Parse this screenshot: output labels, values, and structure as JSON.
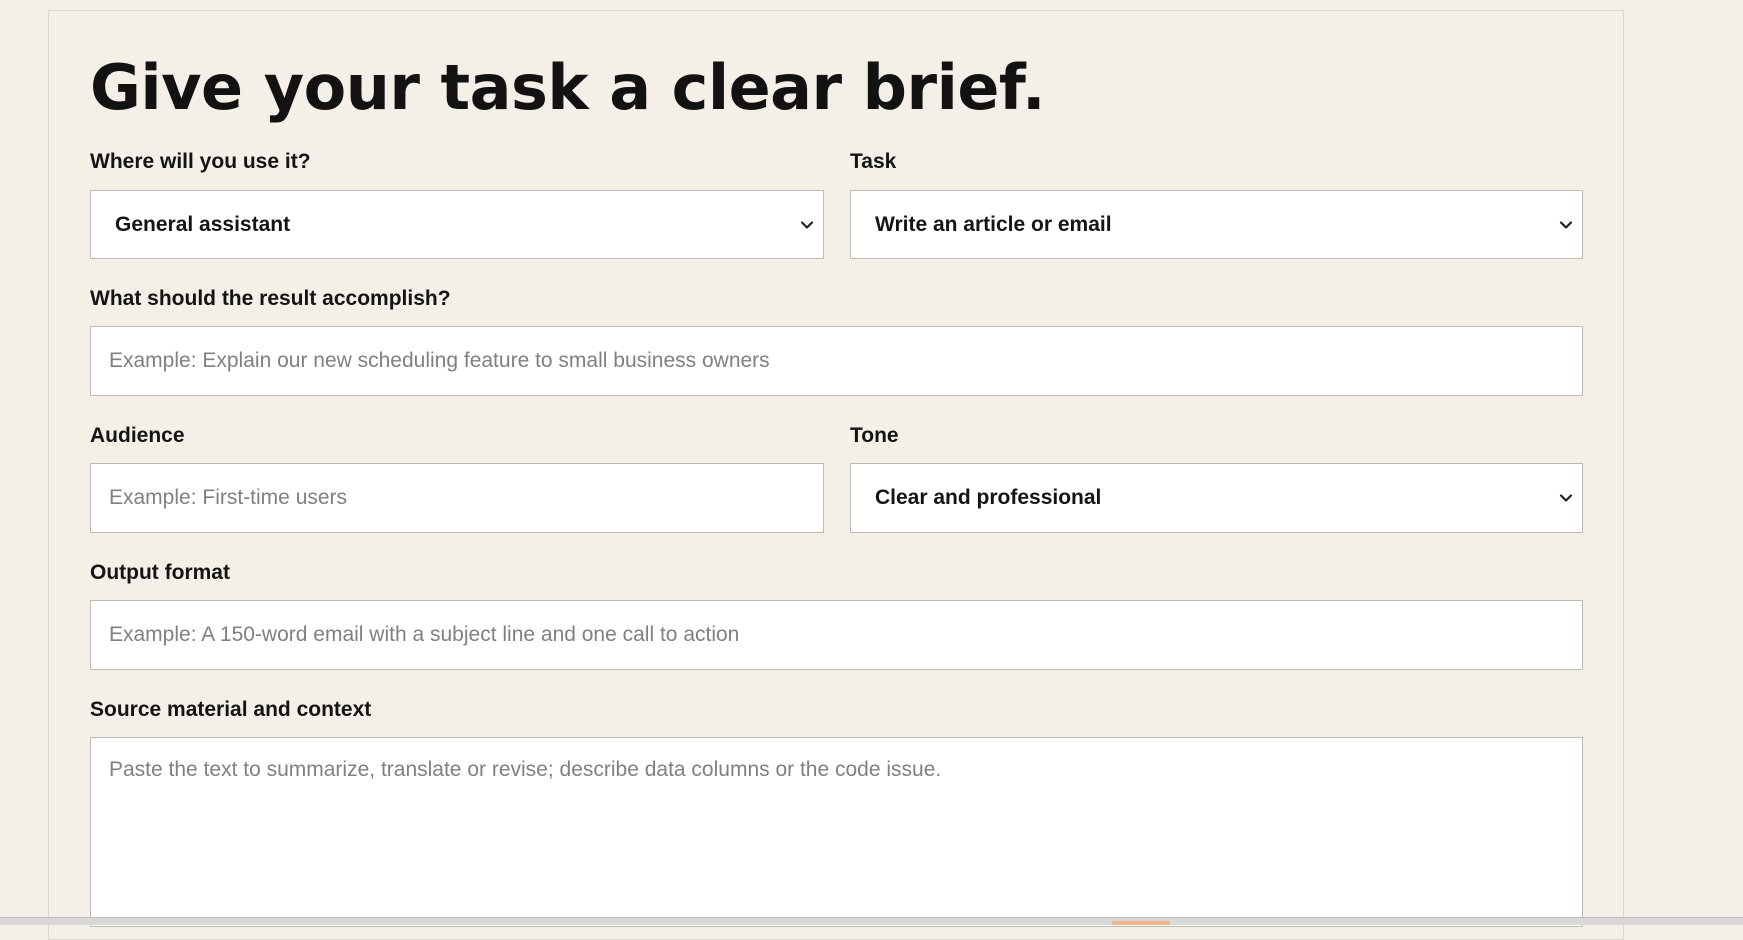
{
  "page": {
    "title": "Give your task a clear brief."
  },
  "form": {
    "use_location": {
      "label": "Where will you use it?",
      "value": "General assistant"
    },
    "task": {
      "label": "Task",
      "value": "Write an article or email"
    },
    "goal": {
      "label": "What should the result accomplish?",
      "placeholder": "Example: Explain our new scheduling feature to small business owners"
    },
    "audience": {
      "label": "Audience",
      "placeholder": "Example: First-time users"
    },
    "tone": {
      "label": "Tone",
      "value": "Clear and professional"
    },
    "output_format": {
      "label": "Output format",
      "placeholder": "Example: A 150-word email with a subject line and one call to action"
    },
    "source": {
      "label": "Source material and context",
      "placeholder": "Paste the text to summarize, translate or revise; describe data columns or the code issue."
    }
  },
  "icons": {
    "select_arrow": "chevron-down-icon"
  }
}
